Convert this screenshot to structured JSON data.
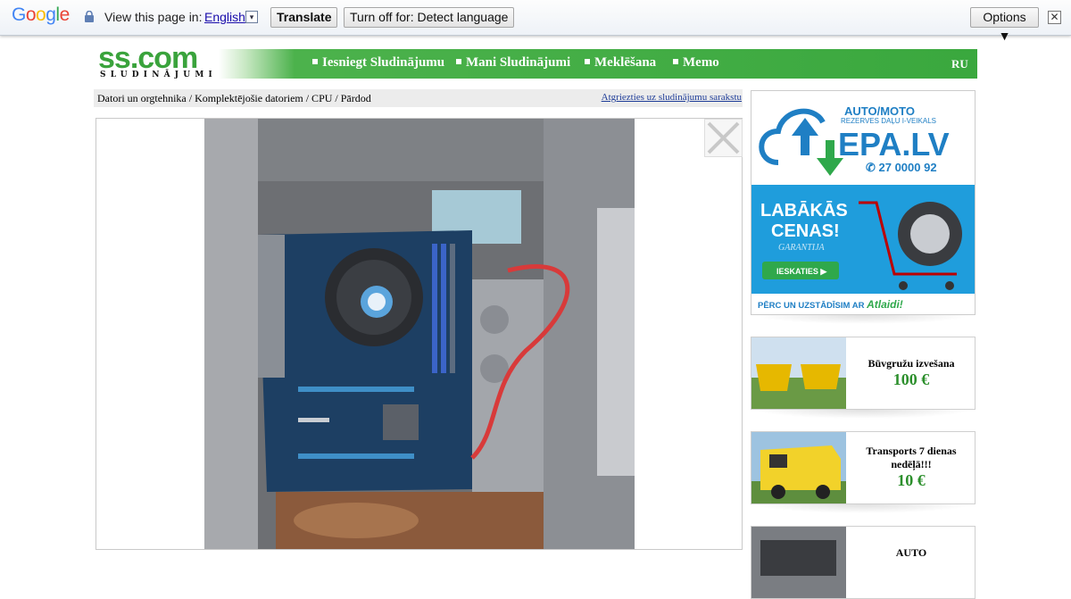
{
  "translate_bar": {
    "logo_letters": [
      "G",
      "o",
      "o",
      "g",
      "l",
      "e"
    ],
    "view_text": "View this page in:",
    "language": "English",
    "language_arrow": "▾",
    "translate_label": "Translate",
    "turnoff_label": "Turn off for: Detect language",
    "options_label": "Options ▼",
    "close_glyph": "✕"
  },
  "header": {
    "logo_main": "ss.com",
    "logo_sub": "SLUDINĀJUMI",
    "nav": [
      {
        "label": "Iesniegt Sludinājumu"
      },
      {
        "label": "Mani Sludinājumi"
      },
      {
        "label": "Meklēšana"
      },
      {
        "label": "Memo"
      }
    ],
    "lang_switch": "RU"
  },
  "breadcrumb": {
    "path": "Datori un orgtehnika / Komplektējošie datoriem / CPU / Pārdod",
    "back_link": "Atgriezties uz sludinājumu sarakstu"
  },
  "ads": {
    "main": {
      "headline1": "AUTO/MOTO",
      "headline2": "REZERVES DAĻU I-VEIKALS",
      "brand": "EPA.LV",
      "phone": "✆ 27 0000 92",
      "offer1": "LABĀKĀS",
      "offer2": "CENAS!",
      "guarantee": "GARANTIJA",
      "cta": "IESKATIES ▶",
      "footer_prefix": "PĒRC UN UZSTĀDĪSIM AR ",
      "footer_brand": "Atlaidi!"
    },
    "cards": [
      {
        "title": "Būvgružu izvešana",
        "price": "100 €"
      },
      {
        "title": "Transports 7 dienas nedēļā!!!",
        "price": "10 €"
      },
      {
        "title": "AUTO",
        "price": ""
      }
    ]
  },
  "colors": {
    "nav_green": "#3aa83e",
    "price_green": "#2c8f2c",
    "link_blue": "#1e3c98",
    "ad_blue": "#1f7fc4"
  }
}
